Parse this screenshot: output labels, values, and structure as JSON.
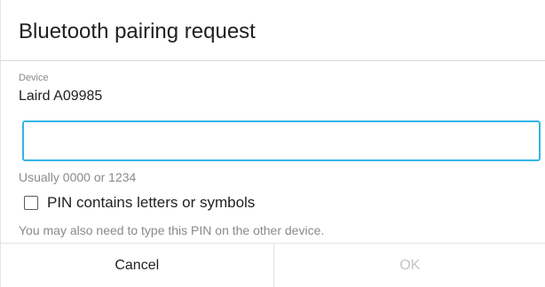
{
  "dialog": {
    "title": "Bluetooth pairing request"
  },
  "device": {
    "label": "Device",
    "name": "Laird A09985"
  },
  "pin_input": {
    "value": "",
    "placeholder": ""
  },
  "hint": "Usually 0000 or 1234",
  "checkbox": {
    "label": "PIN contains letters or symbols",
    "checked": false
  },
  "note": "You may also need to type this PIN on the other device.",
  "buttons": {
    "cancel_label": "Cancel",
    "ok_label": "OK",
    "ok_enabled": false
  },
  "colors": {
    "accent": "#33b5e5",
    "text_primary": "#212121",
    "text_secondary": "#8a8a8a",
    "disabled": "#c4c4c4"
  }
}
